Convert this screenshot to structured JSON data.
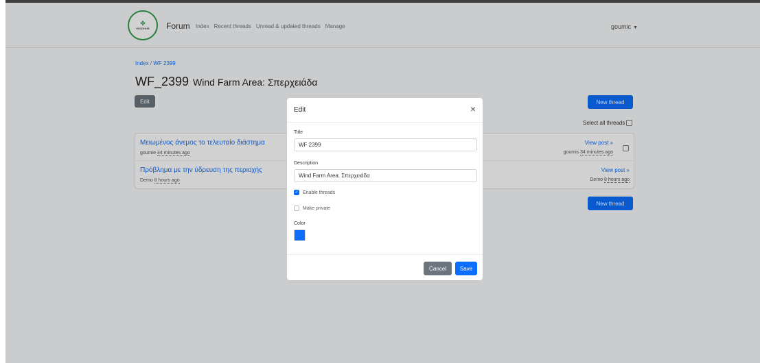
{
  "nav": {
    "logo_text": "WINDHUB",
    "brand": "Forum",
    "links": [
      "Index",
      "Recent threads",
      "Unread & updated threads",
      "Manage"
    ],
    "user": "goumic"
  },
  "breadcrumb": {
    "root": "Index",
    "separator": "/",
    "current": "WF 2399"
  },
  "page": {
    "title": "WF_2399",
    "description": "Wind Farm Area: Σπερχειάδα",
    "edit_label": "Edit",
    "new_thread_label": "New thread",
    "select_all_label": "Select all threads"
  },
  "threads": [
    {
      "title": "Μειωμένος άνεμος το τελευταίο διάστημα",
      "author": "goumie",
      "time": "34 minutes ago",
      "view_label": "View post »",
      "last_author": "goumis",
      "last_time": "34 minutes ago"
    },
    {
      "title": "Πρόβλημα με την ύδρευση της περιοχής",
      "author": "Demo",
      "time": "8 hours ago",
      "view_label": "View post »",
      "last_author": "Demo",
      "last_time": "8 hours ago"
    }
  ],
  "modal": {
    "title": "Edit",
    "close_symbol": "×",
    "title_label": "Title",
    "title_value": "WF 2399",
    "description_label": "Description",
    "description_value": "Wind Farm Area: Σπερχειάδα",
    "enable_threads_label": "Enable threads",
    "enable_threads_checked": true,
    "make_private_label": "Make private",
    "make_private_checked": false,
    "color_label": "Color",
    "color_value": "#0d6efd",
    "cancel_label": "Cancel",
    "save_label": "Save"
  },
  "colors": {
    "primary": "#0d6efd",
    "secondary": "#6c757d",
    "logo_green": "#2e9d4a"
  }
}
